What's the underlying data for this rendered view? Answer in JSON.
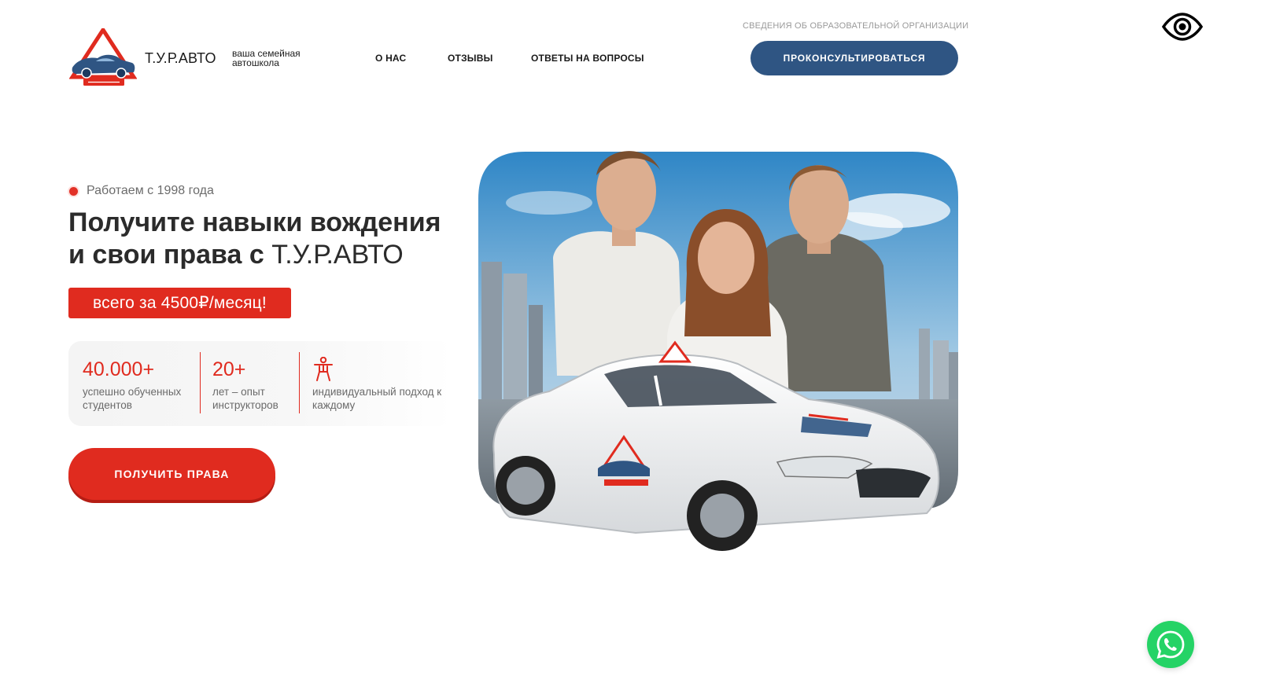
{
  "header": {
    "brand_name": "Т.У.Р.АВТО",
    "tagline": "ваша семейная автошкола",
    "nav": [
      {
        "label": "О НАС"
      },
      {
        "label": "ОТЗЫВЫ"
      },
      {
        "label": "ОТВЕТЫ НА ВОПРОСЫ"
      }
    ],
    "org_info_link": "СВЕДЕНИЯ ОБ ОБРАЗОВАТЕЛЬНОЙ ОРГАНИЗАЦИИ",
    "consult_button": "ПРОКОНСУЛЬТИРОВАТЬСЯ",
    "accessibility_icon": "eye-icon"
  },
  "hero": {
    "since_text": "Работаем с 1998 года",
    "headline_line1": "Получите навыки вождения",
    "headline_line2_prefix": "и свои права с ",
    "headline_brand": "Т.У.Р.АВТО",
    "price_badge": "всего за 4500₽/месяц!",
    "stats": [
      {
        "value": "40.000+",
        "label": "успешно обученных студентов"
      },
      {
        "value": "20+",
        "label": "лет – опыт инструкторов"
      },
      {
        "icon": "person-icon",
        "label": "индивидуальный подход к каждому"
      }
    ],
    "cta_button": "ПОЛУЧИТЬ ПРАВА"
  },
  "floating": {
    "whatsapp_icon": "whatsapp-icon"
  },
  "colors": {
    "accent_red": "#e02b1f",
    "brand_blue": "#2f5583",
    "whatsapp_green": "#25d366"
  }
}
